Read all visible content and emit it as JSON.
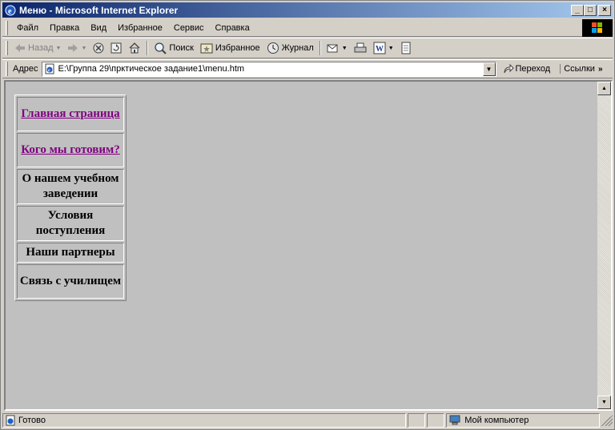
{
  "window": {
    "title": "Меню - Microsoft Internet Explorer",
    "buttons": {
      "minimize": "_",
      "maximize": "□",
      "close": "×"
    }
  },
  "menubar": {
    "items": [
      {
        "label": "Файл"
      },
      {
        "label": "Правка"
      },
      {
        "label": "Вид"
      },
      {
        "label": "Избранное"
      },
      {
        "label": "Сервис"
      },
      {
        "label": "Справка"
      }
    ]
  },
  "toolbar": {
    "back": "Назад",
    "search": "Поиск",
    "favorites": "Избранное",
    "history": "Журнал"
  },
  "address": {
    "label": "Адрес",
    "url": "E:\\Группа 29\\прктическое задание1\\menu.htm",
    "go": "Переход",
    "links": "Ссылки"
  },
  "nav": {
    "items": [
      {
        "label": "Главная страница",
        "visited": true
      },
      {
        "label": "Кого мы готовим?",
        "visited": true
      },
      {
        "label": "О нашем учебном заведении",
        "visited": false
      },
      {
        "label": "Условия поступления",
        "visited": false
      },
      {
        "label": "Наши партнеры",
        "visited": false
      },
      {
        "label": "Связь с училищем",
        "visited": false
      }
    ]
  },
  "status": {
    "text": "Готово",
    "zone": "Мой компьютер"
  },
  "colors": {
    "titlebar_start": "#0a246a",
    "titlebar_end": "#a6caf0",
    "visited_link": "#800080",
    "page_background": "#c0c0c0"
  }
}
